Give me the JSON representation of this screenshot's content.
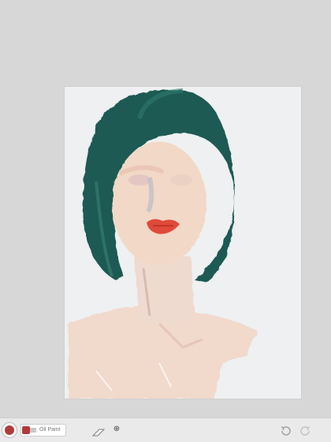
{
  "toolbar": {
    "tool_label": "Oil Paint",
    "settings_symbol": "⊕",
    "icons": {
      "color": "color-swatch-icon",
      "tool": "oil-paint-tube-icon",
      "eraser": "eraser-icon",
      "settings": "tool-settings-icon",
      "undo": "undo-icon",
      "redo": "redo-icon"
    }
  },
  "colors": {
    "current_paint": "#b23a3a",
    "hair": "#1f5a52",
    "skin": "#f0d7c8",
    "lips": "#e04a3a",
    "canvas": "#eef0f1",
    "workspace": "#d7d7d7"
  }
}
